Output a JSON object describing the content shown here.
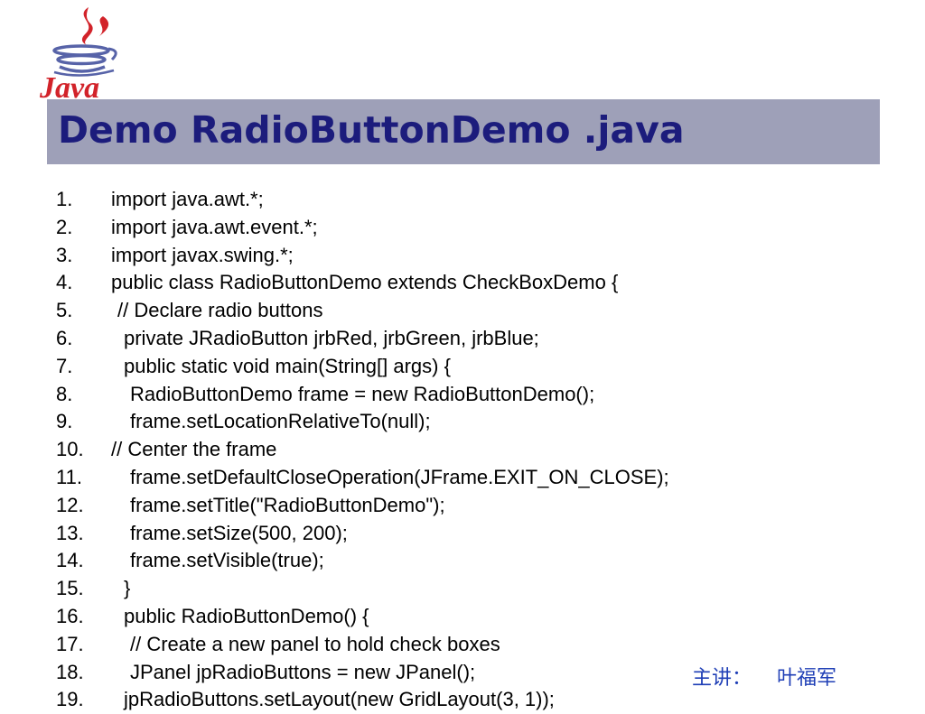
{
  "slide": {
    "title": "Demo RadioButtonDemo .java",
    "logo_text": "Java",
    "logo_icon": "java-coffee-cup-icon",
    "colors": {
      "title_band": "#9ea0b8",
      "title_text": "#1c1c7c",
      "footer_text": "#1f3fb6",
      "logo_red": "#d2232a",
      "logo_blue": "#5763a8"
    }
  },
  "code": {
    "lines": [
      {
        "num": "1.",
        "text": "import java.awt.*;",
        "indent": 0
      },
      {
        "num": "2.",
        "text": "import java.awt.event.*;",
        "indent": 0
      },
      {
        "num": "3.",
        "text": "import javax.swing.*;",
        "indent": 0
      },
      {
        "num": "4.",
        "text": "public class RadioButtonDemo extends CheckBoxDemo {",
        "indent": 0
      },
      {
        "num": "5.",
        "text": "// Declare radio buttons",
        "indent": 1
      },
      {
        "num": "6.",
        "text": "private JRadioButton jrbRed, jrbGreen, jrbBlue;",
        "indent": 2
      },
      {
        "num": "7.",
        "text": "public static void main(String[] args) {",
        "indent": 2
      },
      {
        "num": "8.",
        "text": "RadioButtonDemo frame = new RadioButtonDemo();",
        "indent": 3
      },
      {
        "num": "9.",
        "text": "frame.setLocationRelativeTo(null);",
        "indent": 3
      },
      {
        "num": "10.",
        "text": "// Center the frame",
        "indent": 0
      },
      {
        "num": "11.",
        "text": "frame.setDefaultCloseOperation(JFrame.EXIT_ON_CLOSE);",
        "indent": 3
      },
      {
        "num": "12.",
        "text": "frame.setTitle(\"RadioButtonDemo\");",
        "indent": 3
      },
      {
        "num": "13.",
        "text": "frame.setSize(500, 200);",
        "indent": 3
      },
      {
        "num": "14.",
        "text": "frame.setVisible(true);",
        "indent": 3
      },
      {
        "num": "15.",
        "text": "}",
        "indent": 2
      },
      {
        "num": "16.",
        "text": "public RadioButtonDemo() {",
        "indent": 2
      },
      {
        "num": "17.",
        "text": "// Create a new panel to hold check boxes",
        "indent": 3
      },
      {
        "num": "18.",
        "text": "JPanel jpRadioButtons = new JPanel();",
        "indent": 3
      },
      {
        "num": "19.",
        "text": "jpRadioButtons.setLayout(new GridLayout(3, 1));",
        "indent": 2
      }
    ]
  },
  "footer": {
    "label": "主讲：",
    "name": "叶福军"
  }
}
